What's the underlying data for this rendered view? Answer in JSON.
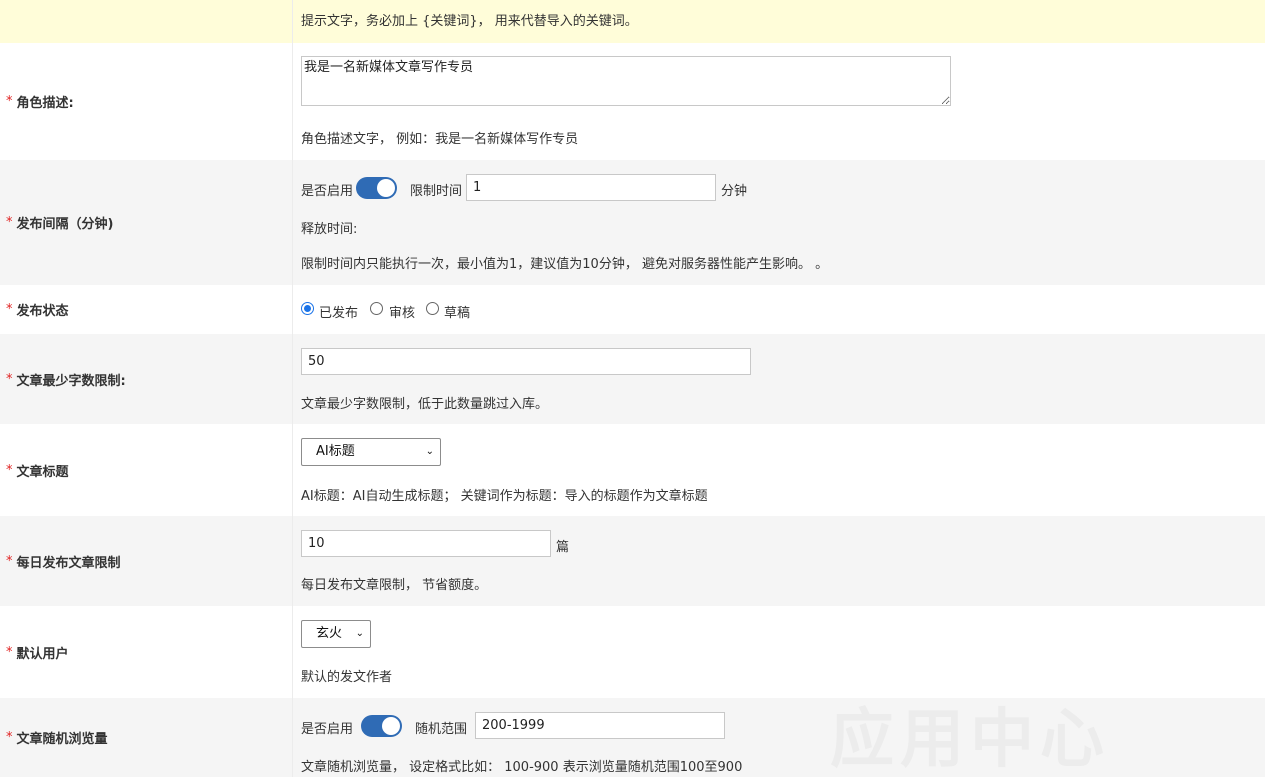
{
  "hint_row": {
    "text": "提示文字，务必加上 {关键词}， 用来代替导入的关键词。"
  },
  "role": {
    "label": "角色描述:",
    "value": "我是一名新媒体文章写作专员",
    "help": "角色描述文字， 例如：我是一名新媒体写作专员"
  },
  "interval": {
    "label": "发布间隔（分钟)",
    "enable_label": "是否启用",
    "enabled": true,
    "limit_label": "限制时间",
    "limit_value": "1",
    "unit": "分钟",
    "release_label": "释放时间:",
    "help": "限制时间内只能执行一次，最小值为1，建议值为10分钟， 避免对服务器性能产生影响。 。"
  },
  "status": {
    "label": "发布状态",
    "options": [
      "已发布",
      "审核",
      "草稿"
    ],
    "selected": "已发布"
  },
  "min_words": {
    "label": "文章最少字数限制:",
    "value": "50",
    "help": "文章最少字数限制，低于此数量跳过入库。"
  },
  "title_mode": {
    "label": "文章标题",
    "selected": "AI标题",
    "help": "AI标题：AI自动生成标题； 关键词作为标题：导入的标题作为文章标题"
  },
  "daily_limit": {
    "label": "每日发布文章限制",
    "value": "10",
    "unit": "篇",
    "help": "每日发布文章限制， 节省额度。"
  },
  "default_user": {
    "label": "默认用户",
    "selected": "玄火",
    "help": "默认的发文作者"
  },
  "random_views": {
    "label": "文章随机浏览量",
    "enable_label": "是否启用",
    "enabled": true,
    "range_label": "随机范围",
    "range_value": "200-1999",
    "help": "文章随机浏览量， 设定格式比如： 100-900 表示浏览量随机范围100至900"
  },
  "watermark": "应用中心",
  "required_mark": "*",
  "chevron": "⌄",
  "colors": {
    "toggle": "#2f6bb5",
    "required": "#e02020",
    "hint_bg": "#fffdd9",
    "alt_row_bg": "#f5f5f5"
  }
}
